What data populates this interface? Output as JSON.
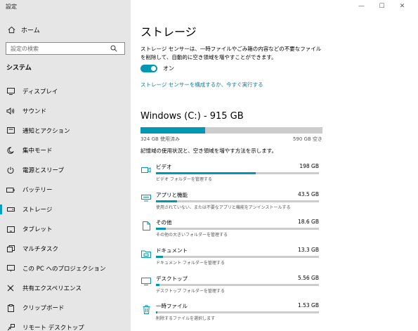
{
  "window": {
    "title": "設定",
    "controls": [
      "—",
      "☐",
      "✕"
    ]
  },
  "sidebar": {
    "home": "ホーム",
    "search_placeholder": "設定の検索",
    "section": "システム",
    "items": [
      {
        "label": "ディスプレイ",
        "icon": "display-icon"
      },
      {
        "label": "サウンド",
        "icon": "sound-icon"
      },
      {
        "label": "通知とアクション",
        "icon": "notification-icon"
      },
      {
        "label": "集中モード",
        "icon": "moon-icon"
      },
      {
        "label": "電源とスリープ",
        "icon": "power-icon"
      },
      {
        "label": "バッテリー",
        "icon": "battery-icon"
      },
      {
        "label": "ストレージ",
        "icon": "storage-icon",
        "active": true
      },
      {
        "label": "タブレット",
        "icon": "tablet-icon"
      },
      {
        "label": "マルチタスク",
        "icon": "multitask-icon"
      },
      {
        "label": "この PC へのプロジェクション",
        "icon": "projection-icon"
      },
      {
        "label": "共有エクスペリエンス",
        "icon": "share-icon"
      },
      {
        "label": "クリップボード",
        "icon": "clipboard-icon"
      },
      {
        "label": "リモート デスクトップ",
        "icon": "remote-desktop-icon"
      }
    ]
  },
  "main": {
    "title": "ストレージ",
    "description": "ストレージ センサーは、一時ファイルやごみ箱の内容などの不要なファイルを削除して、自動的に空き領域を増やすことができます。",
    "toggle_label": "オン",
    "toggle_on": true,
    "config_link": "ストレージ センサーを構成するか、今すぐ実行する",
    "drive": {
      "title": "Windows (C:) - 915 GB",
      "used_label": "324 GB 使用済み",
      "free_label": "590 GB 空き",
      "used_fraction": 0.354,
      "description": "記憶域の使用状況と、空き領域を増やす方法を示します。"
    },
    "categories": [
      {
        "name": "ビデオ",
        "size": "198 GB",
        "sub": "ビデオ フォルダーを管理する",
        "fraction": 0.61,
        "icon": "video-icon"
      },
      {
        "name": "アプリと機能",
        "size": "43.5 GB",
        "sub": "使用されていない、または不要なアプリと機能をアンインストールする",
        "fraction": 0.13,
        "icon": "apps-icon"
      },
      {
        "name": "その他",
        "size": "18.6 GB",
        "sub": "その他の大きいフォルダーを管理する",
        "fraction": 0.06,
        "icon": "other-icon"
      },
      {
        "name": "ドキュメント",
        "size": "13.3 GB",
        "sub": "ドキュメント フォルダーを管理する",
        "fraction": 0.045,
        "icon": "documents-icon"
      },
      {
        "name": "デスクトップ",
        "size": "5.56 GB",
        "sub": "デスクトップ フォルダーを管理する",
        "fraction": 0.02,
        "icon": "desktop-icon"
      },
      {
        "name": "一時ファイル",
        "size": "1.53 GB",
        "sub": "削除するファイルを選択します",
        "fraction": 0.01,
        "icon": "trash-icon"
      }
    ]
  },
  "colors": {
    "accent": "#0097b3",
    "link": "#0f7a9c",
    "sidebar_bg": "#e6e6e6",
    "bar_bg": "#cccccc"
  }
}
